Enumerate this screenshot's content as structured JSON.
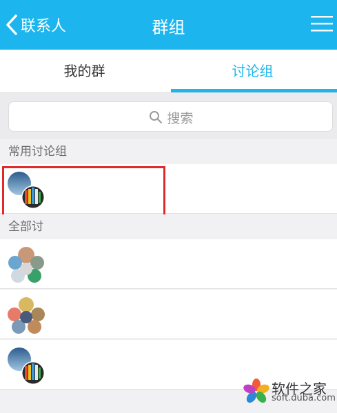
{
  "header": {
    "back_label": "联系人",
    "title": "群组",
    "back_icon": "chevron-left-icon",
    "menu_icon": "menu-icon"
  },
  "tabs": [
    {
      "label": "我的群",
      "active": false
    },
    {
      "label": "讨论组",
      "active": true
    }
  ],
  "search": {
    "placeholder": "搜索",
    "icon": "search-icon"
  },
  "sections": {
    "frequent": "常用讨论组",
    "all": "全部讨"
  },
  "watermark": {
    "title": "软件之家",
    "subtitle": "soft.duba.com"
  },
  "colors": {
    "accent": "#1cb5ee",
    "highlight": "#e02a2a"
  }
}
